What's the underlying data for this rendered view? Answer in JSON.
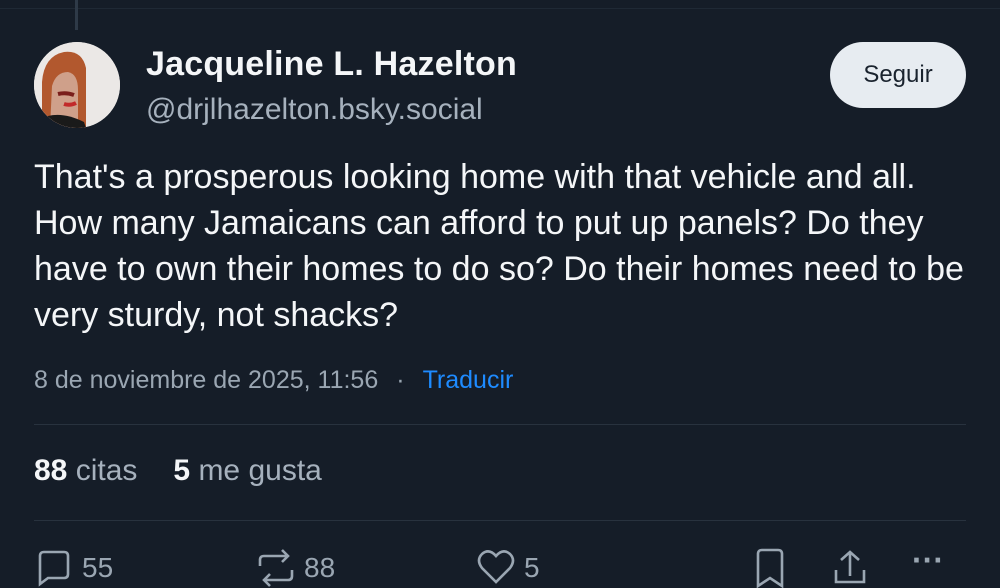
{
  "post": {
    "author_name": "Jacqueline L. Hazelton",
    "author_handle": "@drjlhazelton.bsky.social",
    "follow_label": "Seguir",
    "text": "That's a prosperous looking home with that vehicle and all. How many Jamaicans can afford to put up panels? Do they have to own their homes to do so? Do their homes need to be very sturdy, not shacks?",
    "timestamp": "8 de noviembre de 2025, 11:56",
    "separator": "·",
    "translate_label": "Traducir"
  },
  "stats": {
    "quotes_count": "88",
    "quotes_label": "citas",
    "likes_count": "5",
    "likes_label": "me gusta"
  },
  "actions": {
    "reply_count": "55",
    "repost_count": "88",
    "like_count": "5",
    "more_label": "···"
  },
  "colors": {
    "background": "#151d28",
    "link": "#1e8bff",
    "muted": "#9aa6b2",
    "follow_button_bg": "#e7ecf1"
  }
}
